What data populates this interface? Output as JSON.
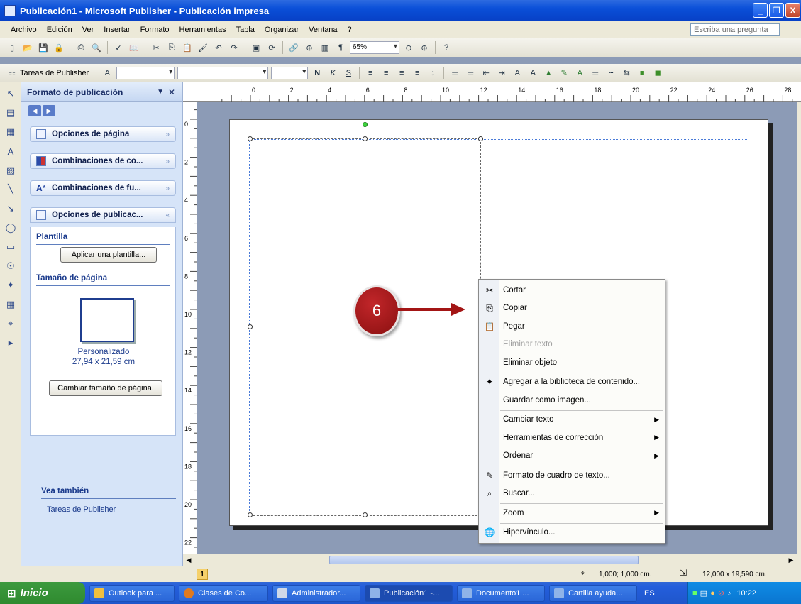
{
  "window": {
    "title": "Publicación1 - Microsoft Publisher - Publicación impresa",
    "min": "_",
    "max": "❐",
    "close": "X"
  },
  "menu": {
    "items": [
      "Archivo",
      "Edición",
      "Ver",
      "Insertar",
      "Formato",
      "Herramientas",
      "Tabla",
      "Organizar",
      "Ventana",
      "?"
    ],
    "ask_placeholder": "Escriba una pregunta"
  },
  "toolbar": {
    "zoom": "65%"
  },
  "formatbar": {
    "tasks_label": "Tareas de Publisher"
  },
  "taskpane": {
    "title": "Formato de publicación",
    "sections": [
      "Opciones de página",
      "Combinaciones de co...",
      "Combinaciones de fu...",
      "Opciones de publicac..."
    ],
    "plantilla_label": "Plantilla",
    "apply_template_button": "Aplicar una plantilla...",
    "page_size_label": "Tamaño de página",
    "page_size_name": "Personalizado",
    "page_size_dims": "27,94 x 21,59 cm",
    "change_size_button": "Cambiar tamaño de página.",
    "see_also_label": "Vea también",
    "see_also_link": "Tareas de Publisher"
  },
  "ruler": {
    "h": [
      "0",
      "2",
      "4",
      "6",
      "8",
      "10",
      "12",
      "14",
      "16",
      "18",
      "20",
      "22",
      "24",
      "26",
      "28"
    ],
    "v": [
      "0",
      "2",
      "4",
      "6",
      "8",
      "10",
      "12",
      "14",
      "16",
      "18",
      "20",
      "22"
    ]
  },
  "context_menu": [
    {
      "label": "Cortar",
      "icon": "scissors-icon",
      "glyph": "✂"
    },
    {
      "label": "Copiar",
      "icon": "copy-icon",
      "glyph": "⎘"
    },
    {
      "label": "Pegar",
      "icon": "paste-icon",
      "glyph": "📋"
    },
    {
      "label": "Eliminar texto",
      "disabled": true
    },
    {
      "label": "Eliminar objeto"
    },
    {
      "label": "Agregar a la biblioteca de contenido...",
      "icon": "library-icon",
      "glyph": "✦"
    },
    {
      "label": "Guardar como imagen..."
    },
    {
      "label": "Cambiar texto",
      "submenu": true
    },
    {
      "label": "Herramientas de corrección",
      "submenu": true
    },
    {
      "label": "Ordenar",
      "submenu": true
    },
    {
      "label": "Formato de cuadro de texto...",
      "icon": "format-icon",
      "glyph": "✎"
    },
    {
      "label": "Buscar...",
      "icon": "binoculars-icon",
      "glyph": "⌕"
    },
    {
      "label": "Zoom",
      "submenu": true
    },
    {
      "label": "Hipervínculo...",
      "icon": "hyperlink-icon",
      "glyph": "🌐"
    }
  ],
  "callout": {
    "number": "6"
  },
  "status": {
    "page": "1",
    "position": "1,000; 1,000 cm.",
    "size": "12,000 x 19,590 cm."
  },
  "taskbar": {
    "start": "Inicio",
    "tasks": [
      "Outlook para ...",
      "Clases de Co...",
      "Administrador...",
      "Publicación1 -...",
      "Documento1 ...",
      "Cartilla ayuda..."
    ],
    "lang": "ES",
    "clock": "10:22"
  }
}
